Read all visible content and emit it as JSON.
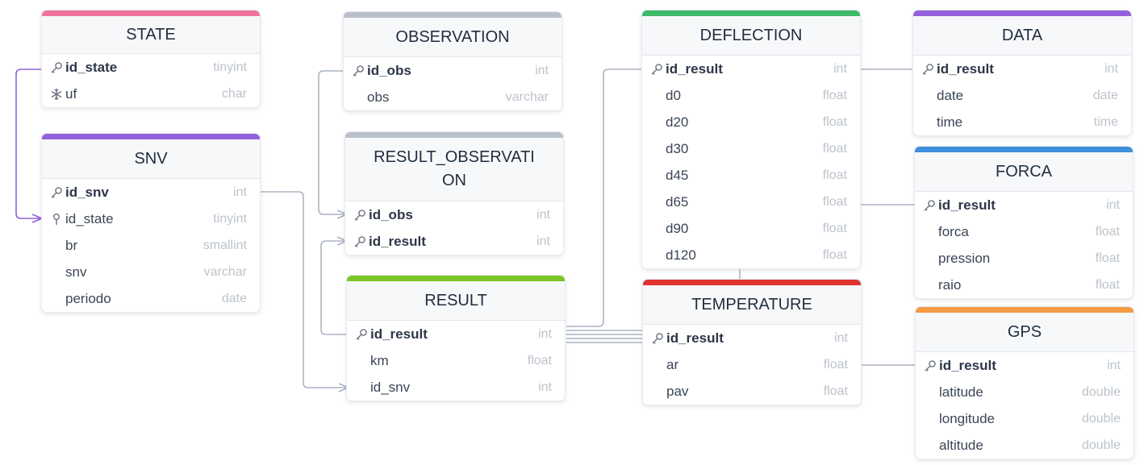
{
  "colors": {
    "state": "#f0739a",
    "snv": "#9461dc",
    "observation": "#b9c0ca",
    "result_observation": "#b9c0ca",
    "result": "#7cc425",
    "deflection": "#3dbb6a",
    "temperature": "#e0322e",
    "data": "#9461dc",
    "forca": "#3f8fdc",
    "gps": "#f59a42",
    "link": "#9aa5b8",
    "link_highlight": "#9461dc"
  },
  "tables": {
    "state": {
      "name": "STATE",
      "fields": [
        {
          "name": "id_state",
          "type": "tinyint",
          "icon": "key-icon",
          "pk": true
        },
        {
          "name": "uf",
          "type": "char",
          "icon": "snowflake-icon",
          "pk": false
        }
      ]
    },
    "snv": {
      "name": "SNV",
      "fields": [
        {
          "name": "id_snv",
          "type": "int",
          "icon": "key-icon",
          "pk": true
        },
        {
          "name": "id_state",
          "type": "tinyint",
          "icon": "pin-icon",
          "pk": false
        },
        {
          "name": "br",
          "type": "smallint",
          "icon": "",
          "pk": false
        },
        {
          "name": "snv",
          "type": "varchar",
          "icon": "",
          "pk": false
        },
        {
          "name": "periodo",
          "type": "date",
          "icon": "",
          "pk": false
        }
      ]
    },
    "observation": {
      "name": "OBSERVATION",
      "fields": [
        {
          "name": "id_obs",
          "type": "int",
          "icon": "key-icon",
          "pk": true
        },
        {
          "name": "obs",
          "type": "varchar",
          "icon": "",
          "pk": false
        }
      ]
    },
    "result_observation": {
      "name": "RESULT_OBSERVATI ON",
      "fields": [
        {
          "name": "id_obs",
          "type": "int",
          "icon": "key-icon",
          "pk": true
        },
        {
          "name": "id_result",
          "type": "int",
          "icon": "key-icon",
          "pk": true
        }
      ]
    },
    "result": {
      "name": "RESULT",
      "fields": [
        {
          "name": "id_result",
          "type": "int",
          "icon": "key-icon",
          "pk": true
        },
        {
          "name": "km",
          "type": "float",
          "icon": "",
          "pk": false
        },
        {
          "name": "id_snv",
          "type": "int",
          "icon": "",
          "pk": false
        }
      ]
    },
    "deflection": {
      "name": "DEFLECTION",
      "fields": [
        {
          "name": "id_result",
          "type": "int",
          "icon": "key-icon",
          "pk": true
        },
        {
          "name": "d0",
          "type": "float",
          "icon": "",
          "pk": false
        },
        {
          "name": "d20",
          "type": "float",
          "icon": "",
          "pk": false
        },
        {
          "name": "d30",
          "type": "float",
          "icon": "",
          "pk": false
        },
        {
          "name": "d45",
          "type": "float",
          "icon": "",
          "pk": false
        },
        {
          "name": "d65",
          "type": "float",
          "icon": "",
          "pk": false
        },
        {
          "name": "d90",
          "type": "float",
          "icon": "",
          "pk": false
        },
        {
          "name": "d120",
          "type": "float",
          "icon": "",
          "pk": false
        }
      ]
    },
    "temperature": {
      "name": "TEMPERATURE",
      "fields": [
        {
          "name": "id_result",
          "type": "int",
          "icon": "key-icon",
          "pk": true
        },
        {
          "name": "ar",
          "type": "float",
          "icon": "",
          "pk": false
        },
        {
          "name": "pav",
          "type": "float",
          "icon": "",
          "pk": false
        }
      ]
    },
    "data": {
      "name": "DATA",
      "fields": [
        {
          "name": "id_result",
          "type": "int",
          "icon": "key-icon",
          "pk": true
        },
        {
          "name": "date",
          "type": "date",
          "icon": "",
          "pk": false
        },
        {
          "name": "time",
          "type": "time",
          "icon": "",
          "pk": false
        }
      ]
    },
    "forca": {
      "name": "FORCA",
      "fields": [
        {
          "name": "id_result",
          "type": "int",
          "icon": "key-icon",
          "pk": true
        },
        {
          "name": "forca",
          "type": "float",
          "icon": "",
          "pk": false
        },
        {
          "name": "pression",
          "type": "float",
          "icon": "",
          "pk": false
        },
        {
          "name": "raio",
          "type": "float",
          "icon": "",
          "pk": false
        }
      ]
    },
    "gps": {
      "name": "GPS",
      "fields": [
        {
          "name": "id_result",
          "type": "int",
          "icon": "key-icon",
          "pk": true
        },
        {
          "name": "latitude",
          "type": "double",
          "icon": "",
          "pk": false
        },
        {
          "name": "longitude",
          "type": "double",
          "icon": "",
          "pk": false
        },
        {
          "name": "altitude",
          "type": "double",
          "icon": "",
          "pk": false
        }
      ]
    }
  }
}
